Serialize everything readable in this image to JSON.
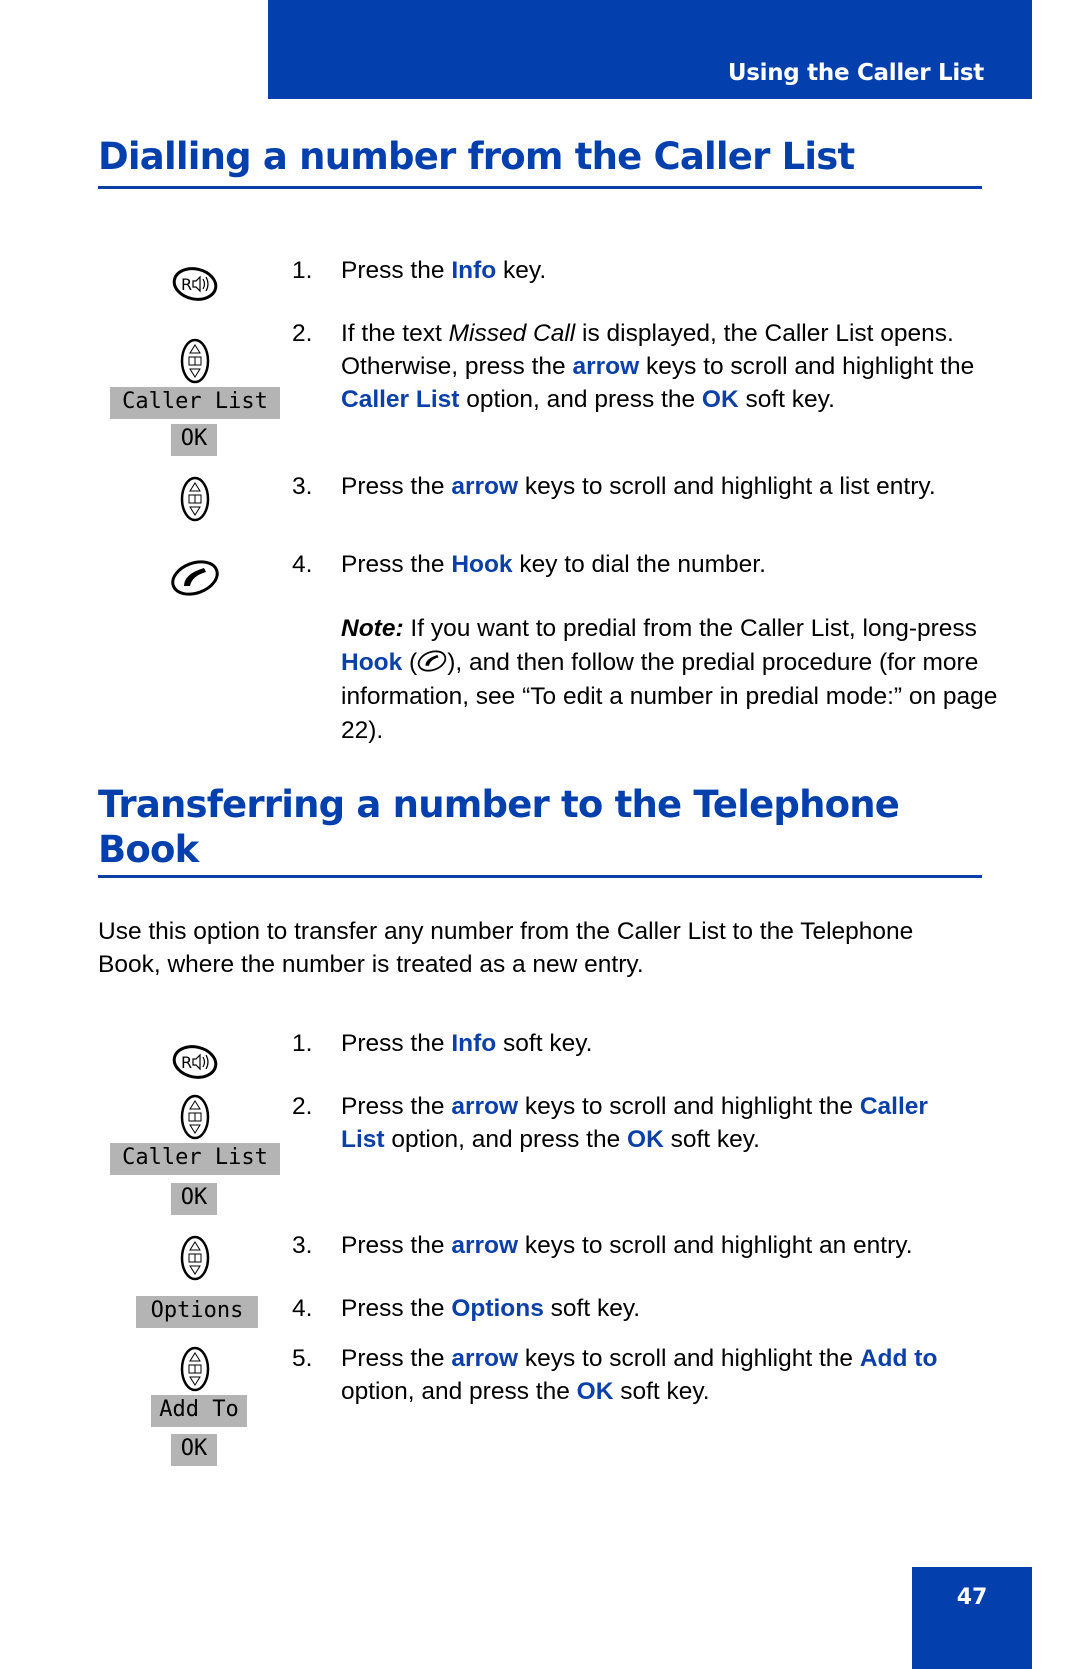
{
  "header": {
    "section_title": "Using the Caller List"
  },
  "section1": {
    "title": "Dialling a number from the Caller List",
    "steps": [
      {
        "num": "1.",
        "parts": [
          "Press the ",
          "Info",
          " key."
        ]
      },
      {
        "num": "2.",
        "parts": [
          "If the text ",
          "Missed Call",
          " is displayed, the Caller List opens. Otherwise, press the ",
          "arrow",
          " keys to scroll and highlight the ",
          "Caller List",
          " option, and press the ",
          "OK",
          " soft key."
        ]
      },
      {
        "num": "3.",
        "parts": [
          "Press the ",
          "arrow",
          " keys to scroll and highlight a list entry."
        ]
      },
      {
        "num": "4.",
        "parts": [
          "Press the ",
          "Hook",
          " key to dial the number."
        ]
      }
    ],
    "note": {
      "label": "Note:",
      "text1": " If you want to predial from the Caller List, long-press ",
      "hook": "Hook",
      "text2": " (",
      "text3": "), and then follow the predial procedure (for more information, see “To edit a number in predial mode:” on page 22)."
    },
    "lcd_labels": {
      "caller_list": "Caller List",
      "ok": "OK"
    }
  },
  "section2": {
    "title_line1": "Transferring a number to the Telephone",
    "title_line2": "Book",
    "intro": "Use this option to transfer any number from the Caller List to the Telephone Book, where the number is treated as a new entry.",
    "steps": [
      {
        "num": "1.",
        "parts": [
          "Press the ",
          "Info",
          " soft key."
        ]
      },
      {
        "num": "2.",
        "parts": [
          "Press the ",
          "arrow",
          " keys to scroll and highlight the ",
          "Caller List",
          " option, and press the ",
          "OK",
          " soft key."
        ]
      },
      {
        "num": "3.",
        "parts": [
          "Press the ",
          "arrow",
          " keys to scroll and highlight an entry."
        ]
      },
      {
        "num": "4.",
        "parts": [
          "Press the ",
          "Options",
          " soft key."
        ]
      },
      {
        "num": "5.",
        "parts": [
          "Press the ",
          "arrow",
          " keys to scroll and highlight the ",
          "Add to",
          " option, and press the ",
          "OK",
          " soft key."
        ]
      }
    ],
    "lcd_labels": {
      "caller_list": "Caller List",
      "ok": "OK",
      "options": "Options",
      "add_to": "Add To",
      "ok2": "OK"
    }
  },
  "footer": {
    "page_number": "47"
  },
  "colors": {
    "brand_blue": "#0340ad",
    "keyword_blue": "#0a40a8",
    "lcd_gray": "#b4b4b4"
  }
}
